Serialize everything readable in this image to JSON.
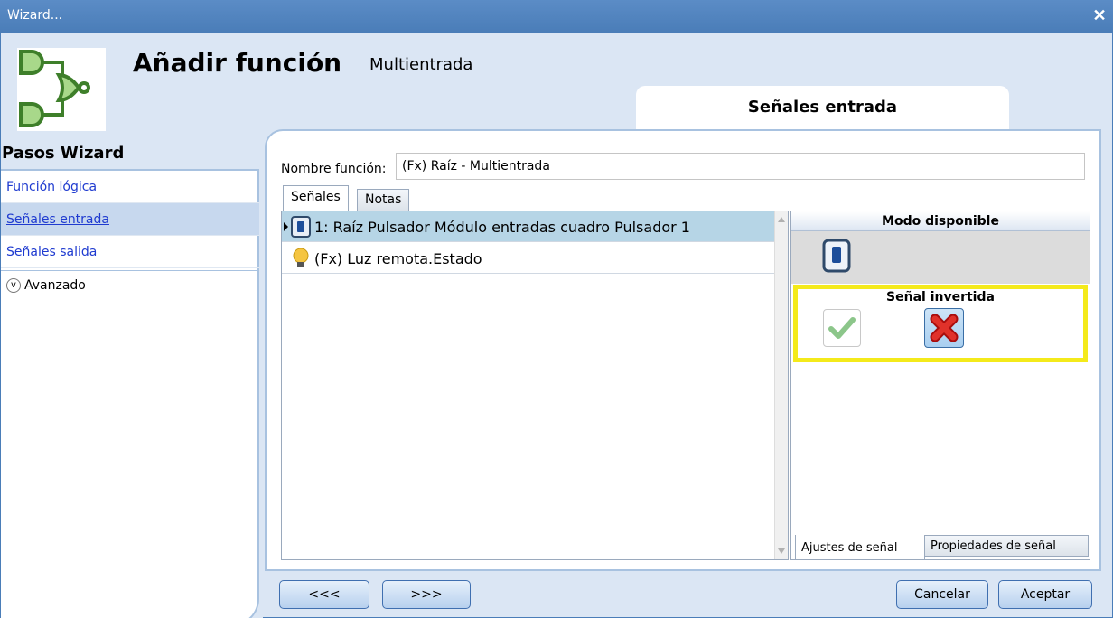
{
  "window": {
    "title": "Wizard..."
  },
  "header": {
    "title": "Añadir función",
    "subtitle": "Multientrada",
    "step_tab": "Señales entrada"
  },
  "sidebar": {
    "heading": "Pasos Wizard",
    "items": [
      {
        "label": "Función lógica"
      },
      {
        "label": "Señales entrada"
      },
      {
        "label": "Señales salida"
      }
    ],
    "advanced_label": "Avanzado"
  },
  "form": {
    "name_label": "Nombre función:",
    "name_value": "(Fx) Raíz - Multientrada"
  },
  "tabs": {
    "signals": "Señales",
    "notes": "Notas"
  },
  "signal_list": [
    {
      "text": "1: Raíz Pulsador Módulo entradas cuadro Pulsador 1",
      "icon": "pushbutton-icon"
    },
    {
      "text": "(Fx) Luz remota.Estado",
      "icon": "lightbulb-icon"
    }
  ],
  "props": {
    "mode_heading": "Modo disponible",
    "inverted_heading": "Señal invertida",
    "tab_settings": "Ajustes de señal",
    "tab_properties": "Propiedades de señal"
  },
  "buttons": {
    "prev": "<<<",
    "next": ">>>",
    "cancel": "Cancelar",
    "accept": "Aceptar"
  },
  "colors": {
    "titlebar": "#4a7db8",
    "highlight": "#f4ea1b",
    "selected_row": "#b6d5e6"
  }
}
